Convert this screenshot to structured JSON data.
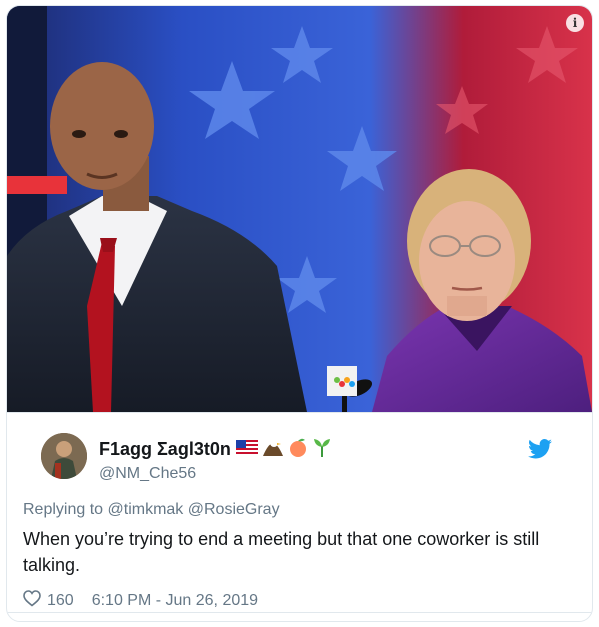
{
  "tweet": {
    "display_name": "F1agg Σagl3t0n",
    "name_emojis": [
      "us-flag-icon",
      "eagle-icon",
      "peach-icon",
      "seedling-icon"
    ],
    "handle": "@NM_Che56",
    "replying_prefix": "Replying to",
    "reply_mentions": [
      "@timkmak",
      "@RosieGray"
    ],
    "text": "When you’re trying to end a meeting but that one coworker is still talking.",
    "likes": "160",
    "timestamp": "6:10 PM - Jun 26, 2019"
  },
  "media": {
    "info_glyph": "i",
    "description_icons": [
      "info-icon"
    ]
  },
  "colors": {
    "twitter_blue": "#1da1f2",
    "secondary_text": "#657786",
    "stage_blue": "#1e3fa8",
    "stage_red": "#c8102e",
    "purple_jacket": "#6a2a9a"
  }
}
